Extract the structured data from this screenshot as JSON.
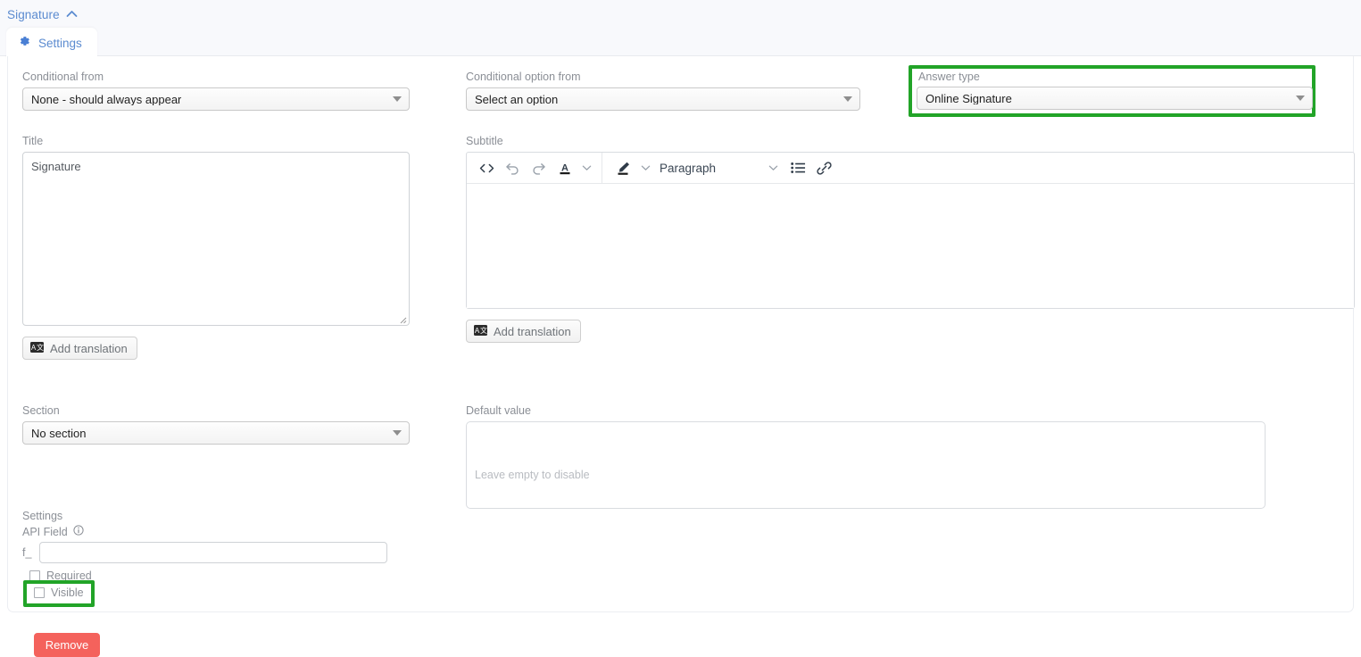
{
  "header": {
    "collapse_title": "Signature",
    "collapse_icon": "chevron-up-icon",
    "tabs": [
      {
        "label": "Settings",
        "icon": "gear-icon",
        "active": true
      }
    ]
  },
  "form": {
    "conditional_from": {
      "label": "Conditional from",
      "value": "None - should always appear"
    },
    "conditional_option_from": {
      "label": "Conditional option from",
      "value": "Select an option"
    },
    "answer_type": {
      "label": "Answer type",
      "value": "Online Signature",
      "highlighted": true,
      "highlight_color": "#22a428"
    },
    "title": {
      "label": "Title",
      "value": "Signature",
      "placeholder": ""
    },
    "title_translation_button": {
      "label": "Add translation",
      "icon": "translate-icon"
    },
    "subtitle": {
      "label": "Subtitle",
      "value": "",
      "toolbar": {
        "buttons": [
          {
            "name": "source-code-icon",
            "glyph": "<>"
          },
          {
            "name": "undo-icon",
            "glyph": "undo"
          },
          {
            "name": "redo-icon",
            "glyph": "redo"
          },
          {
            "name": "text-color-icon",
            "glyph": "A"
          },
          {
            "name": "text-color-chevron-icon",
            "glyph": "chevron-down"
          },
          {
            "name": "highlight-color-icon",
            "glyph": "pen"
          },
          {
            "name": "highlight-color-chevron-icon",
            "glyph": "chevron-down"
          }
        ],
        "block_format": "Paragraph",
        "block_format_chevron": "chevron-down-icon",
        "list_button": "bullet-list-icon",
        "link_button": "link-icon"
      }
    },
    "subtitle_translation_button": {
      "label": "Add translation",
      "icon": "translate-icon"
    },
    "section": {
      "label": "Section",
      "value": "No section"
    },
    "settings": {
      "label": "Settings",
      "api_field": {
        "label": "API Field",
        "info_icon": "info-icon",
        "prefix": "f_",
        "value": "",
        "placeholder": ""
      },
      "required": {
        "label": "Required",
        "checked": false
      },
      "visible": {
        "label": "Visible",
        "checked": false,
        "highlighted": true,
        "highlight_color": "#22a428"
      }
    },
    "remove_button": {
      "label": "Remove",
      "color": "#f4625c"
    },
    "default_value": {
      "label": "Default value",
      "value": "",
      "placeholder": "Leave empty to disable"
    }
  }
}
